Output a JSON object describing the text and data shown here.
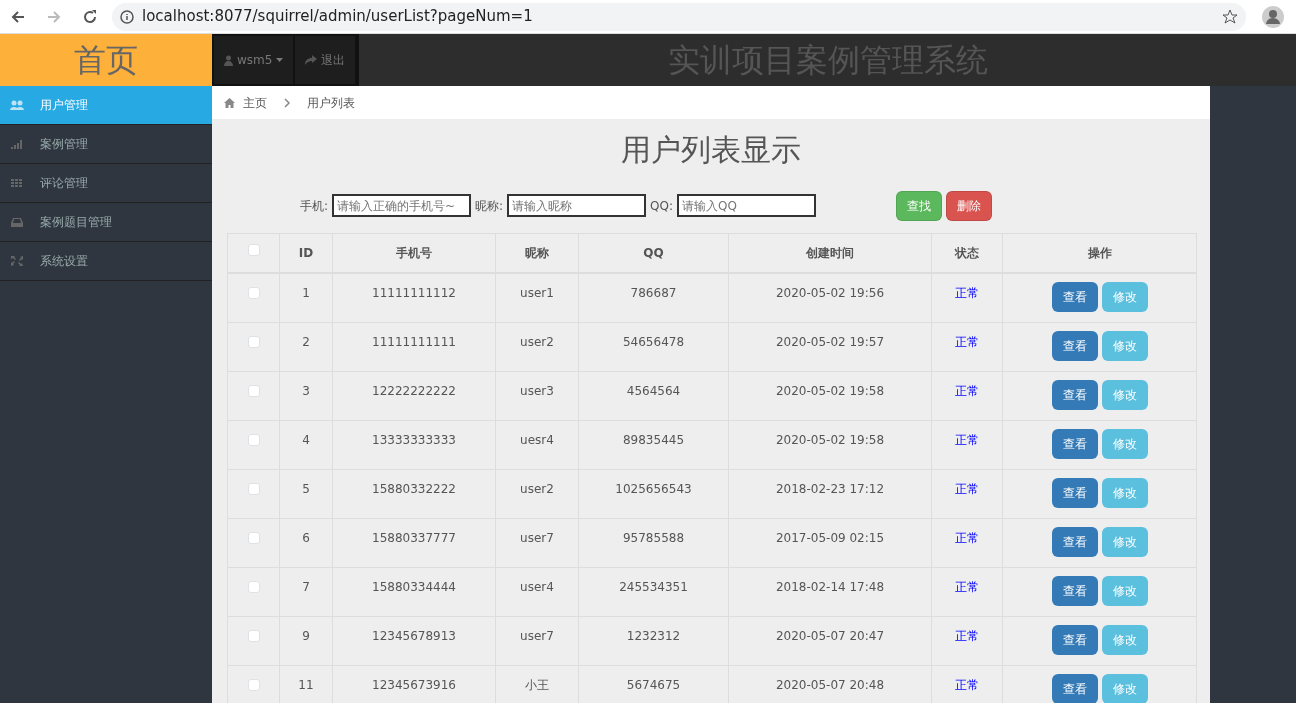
{
  "browser": {
    "url": "localhost:8077/squirrel/admin/userList?pageNum=1"
  },
  "header": {
    "logo": "首页",
    "user": "wsm5",
    "logout": "退出",
    "title": "实训项目案例管理系统"
  },
  "sidebar": {
    "items": [
      {
        "label": "用户管理",
        "selected": true
      },
      {
        "label": "案例管理",
        "selected": false
      },
      {
        "label": "评论管理",
        "selected": false
      },
      {
        "label": "案例题目管理",
        "selected": false
      },
      {
        "label": "系统设置",
        "selected": false
      }
    ]
  },
  "breadcrumb": [
    "主页",
    "用户列表"
  ],
  "page_title": "用户列表显示",
  "filters": [
    {
      "label": "手机:",
      "placeholder": "请输入正确的手机号~"
    },
    {
      "label": "昵称:",
      "placeholder": "请输入昵称"
    },
    {
      "label": "QQ:",
      "placeholder": "请输入QQ"
    }
  ],
  "actions": [
    {
      "label": "查找",
      "kind": "success"
    },
    {
      "label": "删除",
      "kind": "danger"
    }
  ],
  "table": {
    "select_all_checked": false,
    "columns": [
      "ID",
      "手机号",
      "昵称",
      "QQ",
      "创建时间",
      "状态",
      "操作"
    ],
    "rows": [
      {
        "checked": false,
        "cells": [
          "1",
          "11111111112",
          "user1",
          "786687",
          "2020-05-02 19:56"
        ],
        "status": "正常",
        "buttons": [
          "查看",
          "修改"
        ]
      },
      {
        "checked": false,
        "cells": [
          "2",
          "11111111111",
          "user2",
          "54656478",
          "2020-05-02 19:57"
        ],
        "status": "正常",
        "buttons": [
          "查看",
          "修改"
        ]
      },
      {
        "checked": false,
        "cells": [
          "3",
          "12222222222",
          "user3",
          "4564564",
          "2020-05-02 19:58"
        ],
        "status": "正常",
        "buttons": [
          "查看",
          "修改"
        ]
      },
      {
        "checked": false,
        "cells": [
          "4",
          "13333333333",
          "uesr4",
          "89835445",
          "2020-05-02 19:58"
        ],
        "status": "正常",
        "buttons": [
          "查看",
          "修改"
        ]
      },
      {
        "checked": false,
        "cells": [
          "5",
          "15880332222",
          "user2",
          "1025656543",
          "2018-02-23 17:12"
        ],
        "status": "正常",
        "buttons": [
          "查看",
          "修改"
        ]
      },
      {
        "checked": false,
        "cells": [
          "6",
          "15880337777",
          "user7",
          "95785588",
          "2017-05-09 02:15"
        ],
        "status": "正常",
        "buttons": [
          "查看",
          "修改"
        ]
      },
      {
        "checked": false,
        "cells": [
          "7",
          "15880334444",
          "user4",
          "245534351",
          "2018-02-14 17:48"
        ],
        "status": "正常",
        "buttons": [
          "查看",
          "修改"
        ]
      },
      {
        "checked": false,
        "cells": [
          "9",
          "12345678913",
          "user7",
          "1232312",
          "2020-05-07 20:47"
        ],
        "status": "正常",
        "buttons": [
          "查看",
          "修改"
        ]
      },
      {
        "checked": false,
        "cells": [
          "11",
          "12345673916",
          "小王",
          "5674675",
          "2020-05-07 20:48"
        ],
        "status": "正常",
        "buttons": [
          "查看",
          "修改"
        ]
      }
    ]
  }
}
